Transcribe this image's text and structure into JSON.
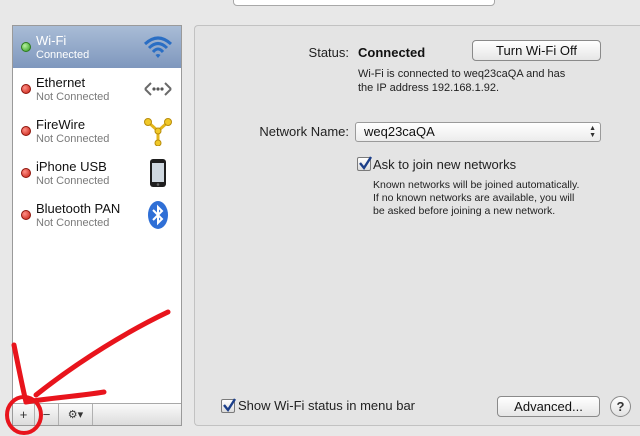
{
  "sidebar": {
    "services": [
      {
        "name": "Wi-Fi",
        "status": "Connected",
        "state": "green",
        "icon": "wifi-icon"
      },
      {
        "name": "Ethernet",
        "status": "Not Connected",
        "state": "red",
        "icon": "ethernet-icon"
      },
      {
        "name": "FireWire",
        "status": "Not Connected",
        "state": "red",
        "icon": "firewire-icon"
      },
      {
        "name": "iPhone USB",
        "status": "Not Connected",
        "state": "red",
        "icon": "iphone-icon"
      },
      {
        "name": "Bluetooth PAN",
        "status": "Not Connected",
        "state": "red",
        "icon": "bluetooth-icon"
      }
    ],
    "add_label": "+",
    "remove_label": "−",
    "action_label": "⚙▾"
  },
  "panel": {
    "status_label": "Status:",
    "status_value": "Connected",
    "turn_off_label": "Turn Wi-Fi Off",
    "status_detail_line1": "Wi-Fi is connected to weq23caQA and has",
    "status_detail_line2": "the IP address 192.168.1.92.",
    "network_name_label": "Network Name:",
    "network_name_value": "weq23caQA",
    "ask_join_label": "Ask to join new networks",
    "ask_join_checked": true,
    "ask_join_help1": "Known networks will be joined automatically.",
    "ask_join_help2": "If no known networks are available, you will",
    "ask_join_help3": "be asked before joining a new network.",
    "show_status_label": "Show Wi-Fi status in menu bar",
    "show_status_checked": true,
    "advanced_label": "Advanced...",
    "help_label": "?"
  },
  "colors": {
    "annotation_red": "#e8141c",
    "selection_blue": "#7e97bd"
  }
}
